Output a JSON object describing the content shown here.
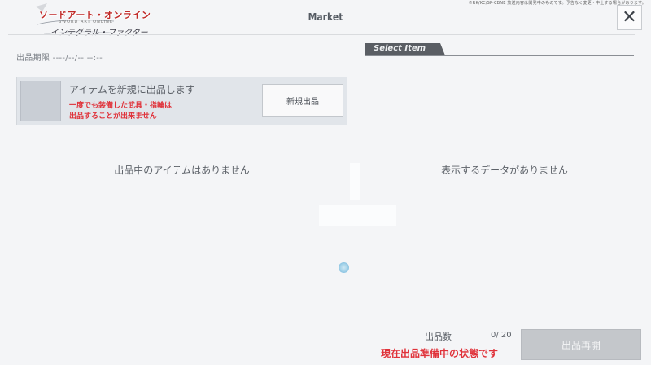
{
  "logo": {
    "title": "ソードアート・オンライン",
    "subtitle": "SWORD ART ONLINE",
    "tagline": "インテグラル・ファクター"
  },
  "copyright": "©RK/KC/SP·CBNE 放送内容は開発中のものです。予告なく変更・中止する場合があります。",
  "header": {
    "title": "Market",
    "close_icon": "close-icon"
  },
  "listing": {
    "deadline": "出品期限 ----/--/-- --:--",
    "new_item": {
      "heading": "アイテムを新規に出品します",
      "warning_line1": "一度でも装備した武具・指輪は",
      "warning_line2": "出品することが出来ません",
      "button_label": "新規出品"
    },
    "empty_message": "出品中のアイテムはありません"
  },
  "select_item": {
    "tab_label": "Select Item",
    "empty_message": "表示するデータがありません"
  },
  "footer": {
    "count_label": "出品数",
    "count_value": "0/ 20",
    "status_message": "現在出品準備中の状態です",
    "resume_button_label": "出品再開"
  },
  "colors": {
    "background": "#f4f5f7",
    "accent_red": "#e0323a",
    "tab_dark": "#5a5e64",
    "disabled_button": "#c4c7cb"
  }
}
